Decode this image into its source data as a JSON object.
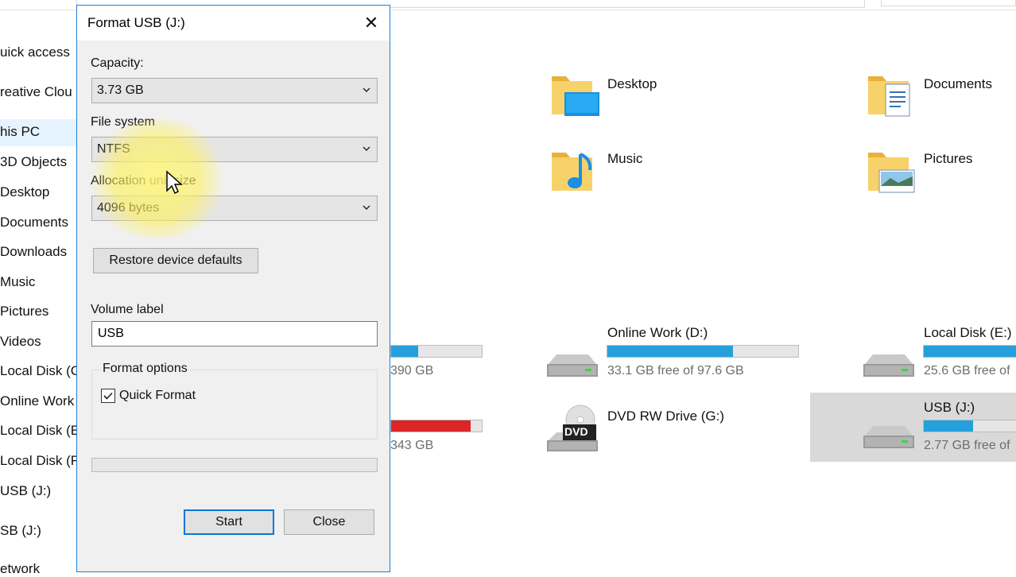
{
  "nav": {
    "items": [
      "uick access",
      "reative Clou",
      "his PC",
      "3D Objects",
      "Desktop",
      "Documents",
      "Downloads",
      "Music",
      "Pictures",
      "Videos",
      "Local Disk (C",
      "Online Work",
      "Local Disk (E",
      "Local Disk (F",
      "USB (J:)",
      "SB (J:)",
      "etwork"
    ]
  },
  "folders": [
    {
      "label": "Desktop",
      "icon": "desktop-folder-icon"
    },
    {
      "label": "Documents",
      "icon": "documents-folder-icon"
    },
    {
      "label": "Music",
      "icon": "music-folder-icon"
    },
    {
      "label": "Pictures",
      "icon": "pictures-folder-icon"
    }
  ],
  "devices": {
    "c_free": "390 GB",
    "f_free": "343 GB",
    "d": {
      "label": "Online Work (D:)",
      "sub": "33.1 GB free of 97.6 GB",
      "used_fraction": 0.66
    },
    "e": {
      "label": "Local Disk (E:)",
      "sub": "25.6 GB free of",
      "used_fraction": 0.74
    },
    "g": {
      "label": "DVD RW Drive (G:)",
      "badge": "DVD"
    },
    "j": {
      "label": "USB (J:)",
      "sub": "2.77 GB free of",
      "used_fraction": 0.26
    }
  },
  "colors": {
    "bar_blue": "#26a0da",
    "bar_red": "#da2626",
    "dialog_border": "#1b7fd6"
  },
  "dialog": {
    "title": "Format USB (J:)",
    "capacity_label": "Capacity:",
    "capacity_value": "3.73 GB",
    "fs_label": "File system",
    "fs_value": "NTFS",
    "alloc_label": "Allocation unit size",
    "alloc_value": "4096 bytes",
    "restore_button": "Restore device defaults",
    "volume_label": "Volume label",
    "volume_value": "USB",
    "format_options": "Format options",
    "quick_format": "Quick Format",
    "start_button": "Start",
    "close_button": "Close"
  }
}
